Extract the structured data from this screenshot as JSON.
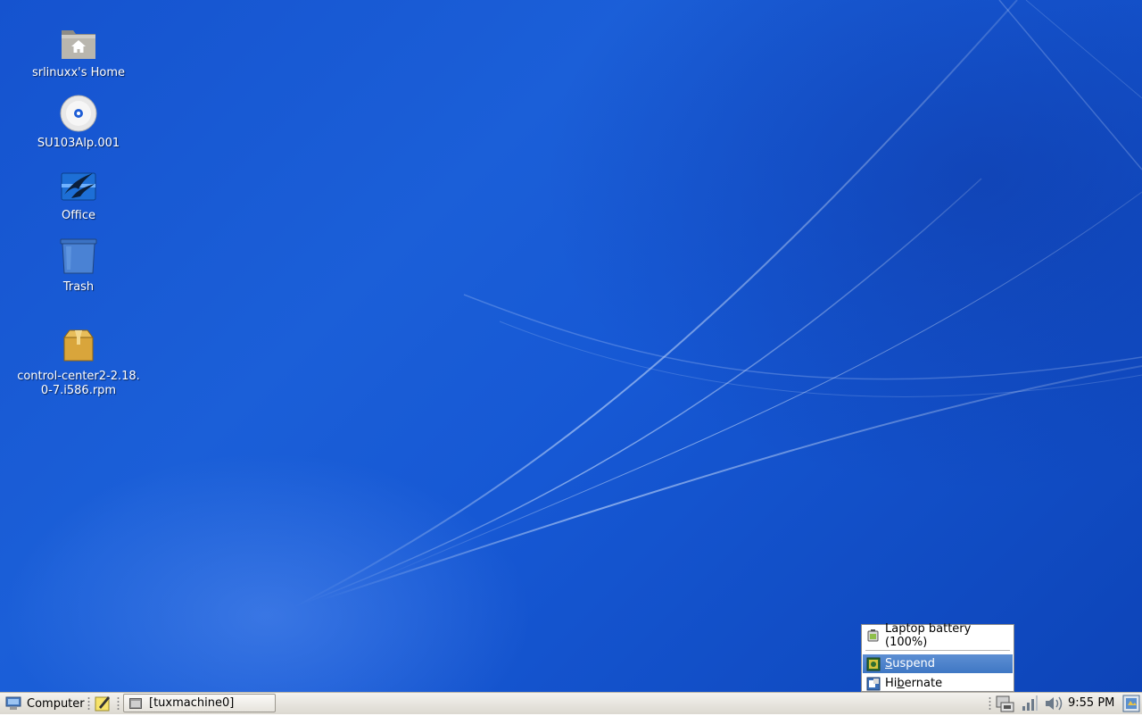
{
  "desktop": {
    "icons": [
      {
        "label": "srlinuxx's Home",
        "icon": "home-folder-icon"
      },
      {
        "label": "SU103Alp.001",
        "icon": "cd-disc-icon"
      },
      {
        "label": "Office",
        "icon": "office-suite-icon"
      },
      {
        "label": "Trash",
        "icon": "trash-icon"
      },
      {
        "label_line1": "control-center2-2.18.",
        "label_line2": "0-7.i586.rpm",
        "icon": "package-icon"
      }
    ]
  },
  "power_menu": {
    "battery_label": "Laptop battery (100%)",
    "items": [
      {
        "label": "Suspend",
        "mnemonic": "S",
        "rest": "uspend",
        "highlighted": true,
        "icon": "suspend-icon"
      },
      {
        "label": "Hibernate",
        "prefix": "Hi",
        "mnemonic": "b",
        "rest": "ernate",
        "highlighted": false,
        "icon": "hibernate-icon"
      }
    ]
  },
  "taskbar": {
    "menu_label": "Computer",
    "window_button_label": "[tuxmachine0]",
    "clock": "9:55 PM",
    "tray_icons": [
      "power-manager-icon",
      "network-signal-icon",
      "volume-icon",
      "notifier-icon"
    ]
  },
  "colors": {
    "desktop_blue": "#1658d4",
    "menu_highlight": "#4a80c9",
    "taskbar_bg": "#e9e6e0"
  }
}
